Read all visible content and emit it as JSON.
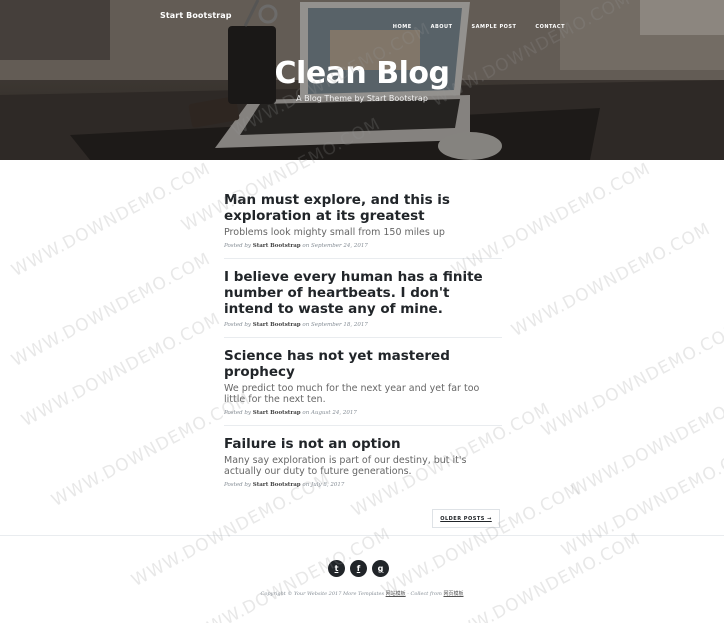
{
  "nav": {
    "brand": "Start Bootstrap",
    "links": [
      "HOME",
      "ABOUT",
      "SAMPLE POST",
      "CONTACT"
    ]
  },
  "header": {
    "title": "Clean Blog",
    "subtitle": "A Blog Theme by Start Bootstrap"
  },
  "posts": [
    {
      "title": "Man must explore, and this is exploration at its greatest",
      "subtitle": "Problems look mighty small from 150 miles up",
      "meta_prefix": "Posted by",
      "author": "Start Bootstrap",
      "meta_on": "on September 24, 2017"
    },
    {
      "title": "I believe every human has a finite number of heartbeats. I don't intend to waste any of mine.",
      "subtitle": "",
      "meta_prefix": "Posted by",
      "author": "Start Bootstrap",
      "meta_on": "on September 18, 2017"
    },
    {
      "title": "Science has not yet mastered prophecy",
      "subtitle": "We predict too much for the next year and yet far too little for the next ten.",
      "meta_prefix": "Posted by",
      "author": "Start Bootstrap",
      "meta_on": "on August 24, 2017"
    },
    {
      "title": "Failure is not an option",
      "subtitle": "Many say exploration is part of our destiny, but it's actually our duty to future generations.",
      "meta_prefix": "Posted by",
      "author": "Start Bootstrap",
      "meta_on": "on July 8, 2017"
    }
  ],
  "pager": {
    "older_label": "OLDER POSTS →"
  },
  "footer": {
    "social": [
      "twitter-icon",
      "facebook-icon",
      "github-icon"
    ],
    "social_glyphs": [
      "t",
      "f",
      "g"
    ],
    "copyright_text": "Copyright © Your Website 2017 More Templates",
    "link_1": "网站模板",
    "mid_text": " - Collect from ",
    "link_2": "网页模板"
  },
  "watermark": "WWW.DOWNDEMO.COM"
}
